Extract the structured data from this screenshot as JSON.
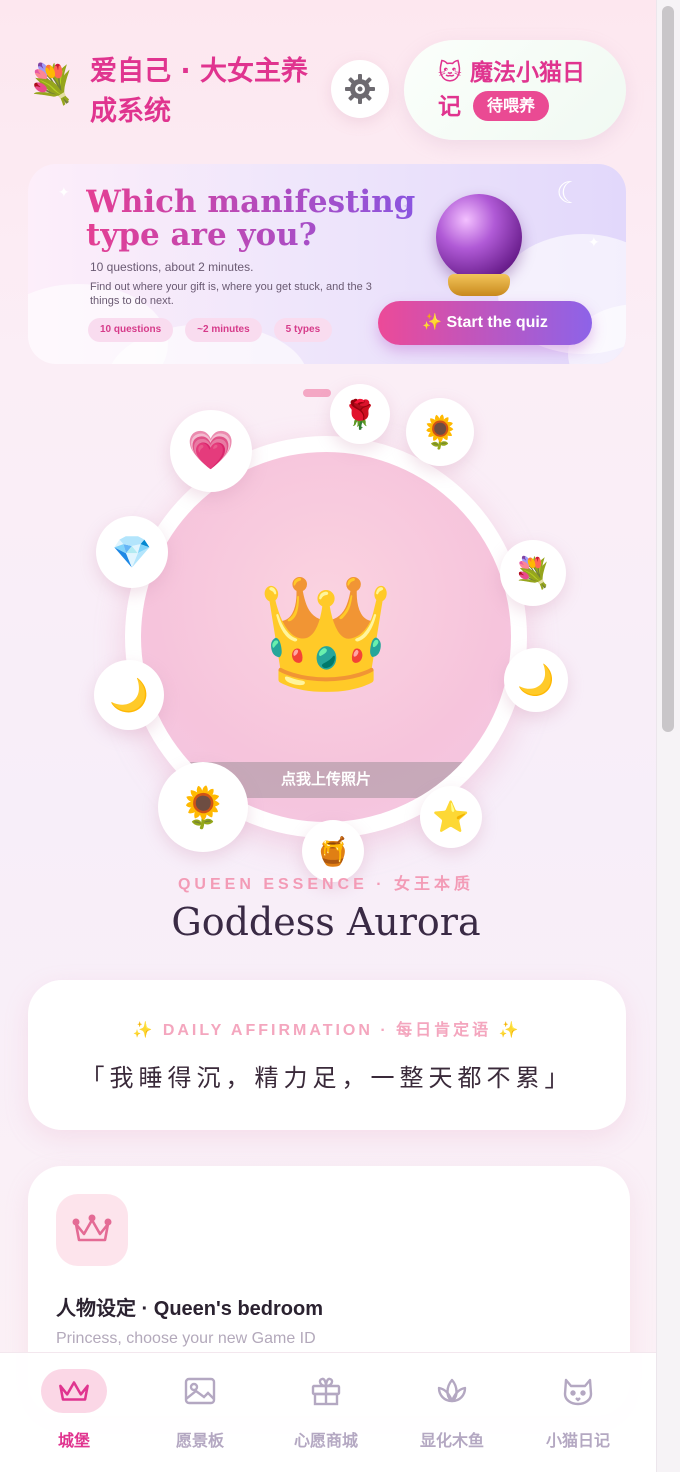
{
  "header": {
    "logo_emoji": "💐",
    "app_title": "爱自己 · 大女主养成系统",
    "settings_icon": "gear-icon",
    "diary_emoji": "🐱",
    "diary_title": "魔法小猫日记",
    "diary_badge": "待喂养"
  },
  "quiz_banner": {
    "title": "Which manifesting type are you?",
    "subtitle": "10 questions, about 2 minutes.",
    "description": "Find out where your gift is, where you get stuck, and the 3 things to do next.",
    "chips": [
      "10 questions",
      "~2 minutes",
      "5 types"
    ],
    "button_label": "✨ Start the quiz",
    "orb_icon": "crystal-ball-icon"
  },
  "avatar": {
    "center_emoji": "👑",
    "upload_label": "点我上传照片",
    "orbit_emojis": [
      "🌹",
      "🌻",
      "💐",
      "🌙",
      "⭐",
      "🍯",
      "🌻",
      "🌙",
      "💎",
      "💗"
    ]
  },
  "identity": {
    "essence_label": "QUEEN ESSENCE · 女王本质",
    "name": "Goddess Aurora"
  },
  "affirmation": {
    "label": "✨ DAILY AFFIRMATION · 每日肯定语 ✨",
    "text": "「我睡得沉，精力足，一整天都不累」"
  },
  "character_card": {
    "icon": "crown-outline-icon",
    "title": "人物设定 · Queen's bedroom",
    "subtitle": "Princess, choose your new Game ID"
  },
  "bottom_nav": {
    "items": [
      {
        "label": "城堡",
        "icon": "crown-icon",
        "active": true
      },
      {
        "label": "愿景板",
        "icon": "image-icon",
        "active": false
      },
      {
        "label": "心愿商城",
        "icon": "gift-icon",
        "active": false
      },
      {
        "label": "显化木鱼",
        "icon": "lotus-icon",
        "active": false
      },
      {
        "label": "小猫日记",
        "icon": "cat-icon",
        "active": false
      }
    ]
  },
  "colors": {
    "accent_pink": "#e0348f",
    "soft_pink": "#f39bb6",
    "purple": "#8d63e8"
  }
}
